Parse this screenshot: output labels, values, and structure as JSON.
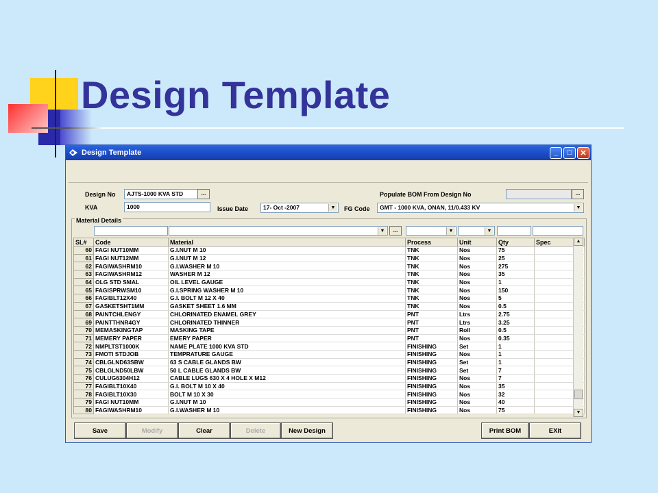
{
  "slide": {
    "title": "Design Template"
  },
  "window": {
    "title": "Design Template",
    "controls": {
      "minimize": "_",
      "maximize": "□",
      "close": "✕"
    }
  },
  "form": {
    "design_no_label": "Design No",
    "design_no_value": "AJTS-1000 KVA STD",
    "kva_label": "KVA",
    "kva_value": "1000",
    "issue_date_label": "Issue Date",
    "issue_date_value": "17- Oct -2007",
    "populate_label": "Populate BOM From Design No",
    "populate_value": "",
    "fg_code_label": "FG Code",
    "fg_code_value": "GMT - 1000 KVA, ONAN, 11/0.433 KV",
    "ellipsis": "..."
  },
  "materials": {
    "group_label": "Material Details",
    "columns": [
      "SL#",
      "Code",
      "Material",
      "Process",
      "Unit",
      "Qty",
      "Spec"
    ],
    "rows": [
      [
        "60",
        "FAGI NUT10MM",
        "G.I.NUT M 10",
        "TNK",
        "Nos",
        "75",
        ""
      ],
      [
        "61",
        "FAGI NUT12MM",
        "G.I.NUT M 12",
        "TNK",
        "Nos",
        "25",
        ""
      ],
      [
        "62",
        "FAGIWASHRM10",
        "G.I.WASHER M 10",
        "TNK",
        "Nos",
        "275",
        ""
      ],
      [
        "63",
        "FAGIWASHRM12",
        "WASHER M 12",
        "TNK",
        "Nos",
        "35",
        ""
      ],
      [
        "64",
        "OLG STD SMAL",
        "OIL LEVEL GAUGE",
        "TNK",
        "Nos",
        "1",
        ""
      ],
      [
        "65",
        "FAGISPRWSM10",
        "G.I.SPRING WASHER M 10",
        "TNK",
        "Nos",
        "150",
        ""
      ],
      [
        "66",
        "FAGIBLT12X40",
        "G.I. BOLT M 12 X 40",
        "TNK",
        "Nos",
        "5",
        ""
      ],
      [
        "67",
        "GASKETSHT1MM",
        "GASKET SHEET 1.6 MM",
        "TNK",
        "Nos",
        "0.5",
        ""
      ],
      [
        "68",
        "PAINTCHLENGY",
        "CHLORINATED ENAMEL GREY",
        "PNT",
        "Ltrs",
        "2.75",
        ""
      ],
      [
        "69",
        "PAINTTHNR4GY",
        "CHLORINATED THINNER",
        "PNT",
        "Ltrs",
        "3.25",
        ""
      ],
      [
        "70",
        "MEMASKINGTAP",
        "MASKING TAPE",
        "PNT",
        "Roll",
        "0.5",
        ""
      ],
      [
        "71",
        "MEMERY PAPER",
        "EMERY PAPER",
        "PNT",
        "Nos",
        "0.35",
        ""
      ],
      [
        "72",
        "NMPLTST1000K",
        "NAME PLATE 1000 KVA STD",
        "FINISHING",
        "Set",
        "1",
        ""
      ],
      [
        "73",
        "FMOTI STDJOB",
        "TEMPRATURE GAUGE",
        "FINISHING",
        "Nos",
        "1",
        ""
      ],
      [
        "74",
        "CBLGLND63SBW",
        "63 S CABLE GLANDS BW",
        "FINISHING",
        "Set",
        "1",
        ""
      ],
      [
        "75",
        "CBLGLND50LBW",
        "50 L CABLE GLANDS BW",
        "FINISHING",
        "Set",
        "7",
        ""
      ],
      [
        "76",
        "CULUG6304H12",
        "CABLE LUGS 630 X 4 HOLE X M12",
        "FINISHING",
        "Nos",
        "7",
        ""
      ],
      [
        "77",
        "FAGIBLT10X40",
        "G.I. BOLT M 10 X 40",
        "FINISHING",
        "Nos",
        "35",
        ""
      ],
      [
        "78",
        "FAGIBLT10X30",
        "BOLT M 10 X 30",
        "FINISHING",
        "Nos",
        "32",
        ""
      ],
      [
        "79",
        "FAGI NUT10MM",
        "G.I.NUT M 10",
        "FINISHING",
        "Nos",
        "40",
        ""
      ],
      [
        "80",
        "FAGIWASHRM10",
        "G.I.WASHER M 10",
        "FINISHING",
        "Nos",
        "75",
        ""
      ]
    ]
  },
  "buttons": {
    "save": "Save",
    "modify": "Modify",
    "clear": "Clear",
    "delete": "Delete",
    "new_design": "New Design",
    "print_bom": "Print BOM",
    "exit": "EXit"
  },
  "icons": {
    "dropdown": "▼",
    "scroll_up": "▲",
    "scroll_down": "▼"
  }
}
